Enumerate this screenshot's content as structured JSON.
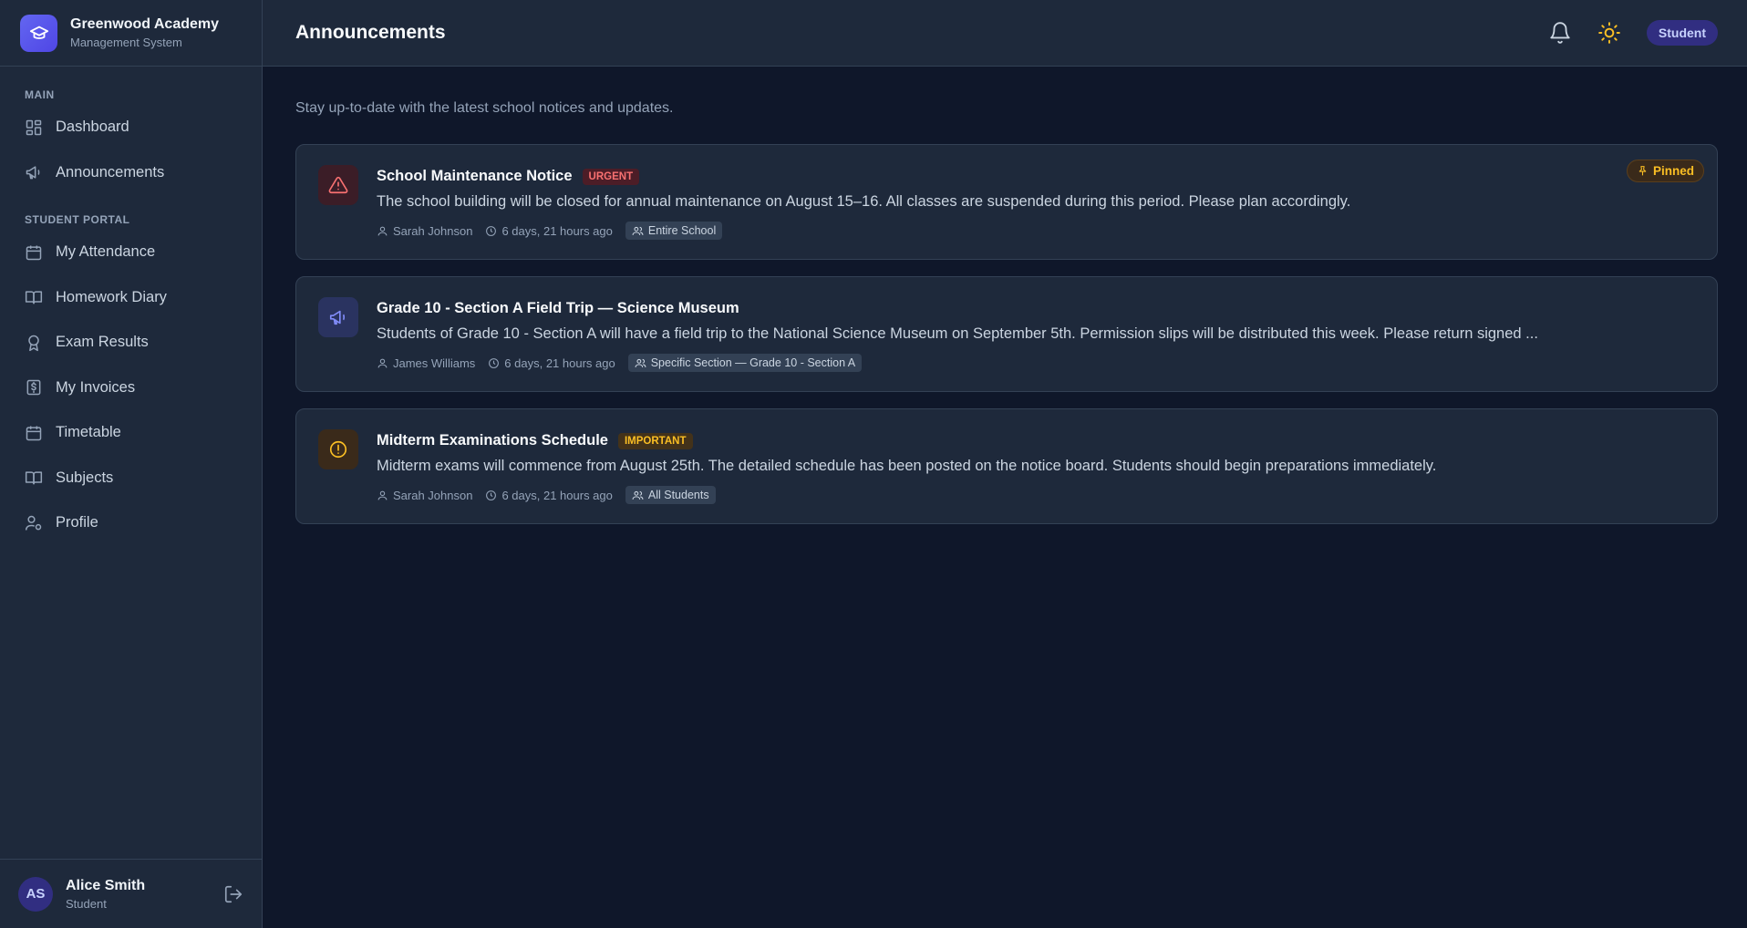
{
  "brand": {
    "title": "Greenwood Academy",
    "subtitle": "Management System"
  },
  "nav": {
    "section_main": "MAIN",
    "section_portal": "STUDENT PORTAL",
    "items": [
      {
        "label": "Dashboard",
        "icon": "dashboard-icon"
      },
      {
        "label": "Announcements",
        "icon": "megaphone-icon"
      },
      {
        "label": "My Attendance",
        "icon": "calendar-icon"
      },
      {
        "label": "Homework Diary",
        "icon": "book-open-icon"
      },
      {
        "label": "Exam Results",
        "icon": "award-icon"
      },
      {
        "label": "My Invoices",
        "icon": "receipt-icon"
      },
      {
        "label": "Timetable",
        "icon": "calendar-grid-icon"
      },
      {
        "label": "Subjects",
        "icon": "book-icon"
      },
      {
        "label": "Profile",
        "icon": "user-gear-icon"
      }
    ]
  },
  "user": {
    "initials": "AS",
    "name": "Alice Smith",
    "role": "Student"
  },
  "header": {
    "title": "Announcements",
    "role_badge": "Student"
  },
  "page": {
    "subtitle": "Stay up-to-date with the latest school notices and updates."
  },
  "announcements": [
    {
      "title": "School Maintenance Notice",
      "tag": "URGENT",
      "text": "The school building will be closed for annual maintenance on August 15–16. All classes are suspended during this period. Please plan accordingly.",
      "author": "Sarah Johnson",
      "time": "6 days, 21 hours ago",
      "audience": "Entire School",
      "pinned": "Pinned",
      "icon": "alert-triangle-icon"
    },
    {
      "title": "Grade 10 - Section A Field Trip — Science Museum",
      "tag": "",
      "text": "Students of Grade 10 - Section A will have a field trip to the National Science Museum on September 5th. Permission slips will be distributed this week. Please return signed ...",
      "author": "James Williams",
      "time": "6 days, 21 hours ago",
      "audience": "Specific Section — Grade 10 - Section A",
      "icon": "megaphone-icon"
    },
    {
      "title": "Midterm Examinations Schedule",
      "tag": "IMPORTANT",
      "text": "Midterm exams will commence from August 25th. The detailed schedule has been posted on the notice board. Students should begin preparations immediately.",
      "author": "Sarah Johnson",
      "time": "6 days, 21 hours ago",
      "audience": "All Students",
      "icon": "alert-circle-icon"
    }
  ],
  "colors": {
    "accent": "#6366f1",
    "urgent": "#f87171",
    "important": "#fbbf24",
    "background": "#0f172a",
    "panel": "#1e293b"
  }
}
